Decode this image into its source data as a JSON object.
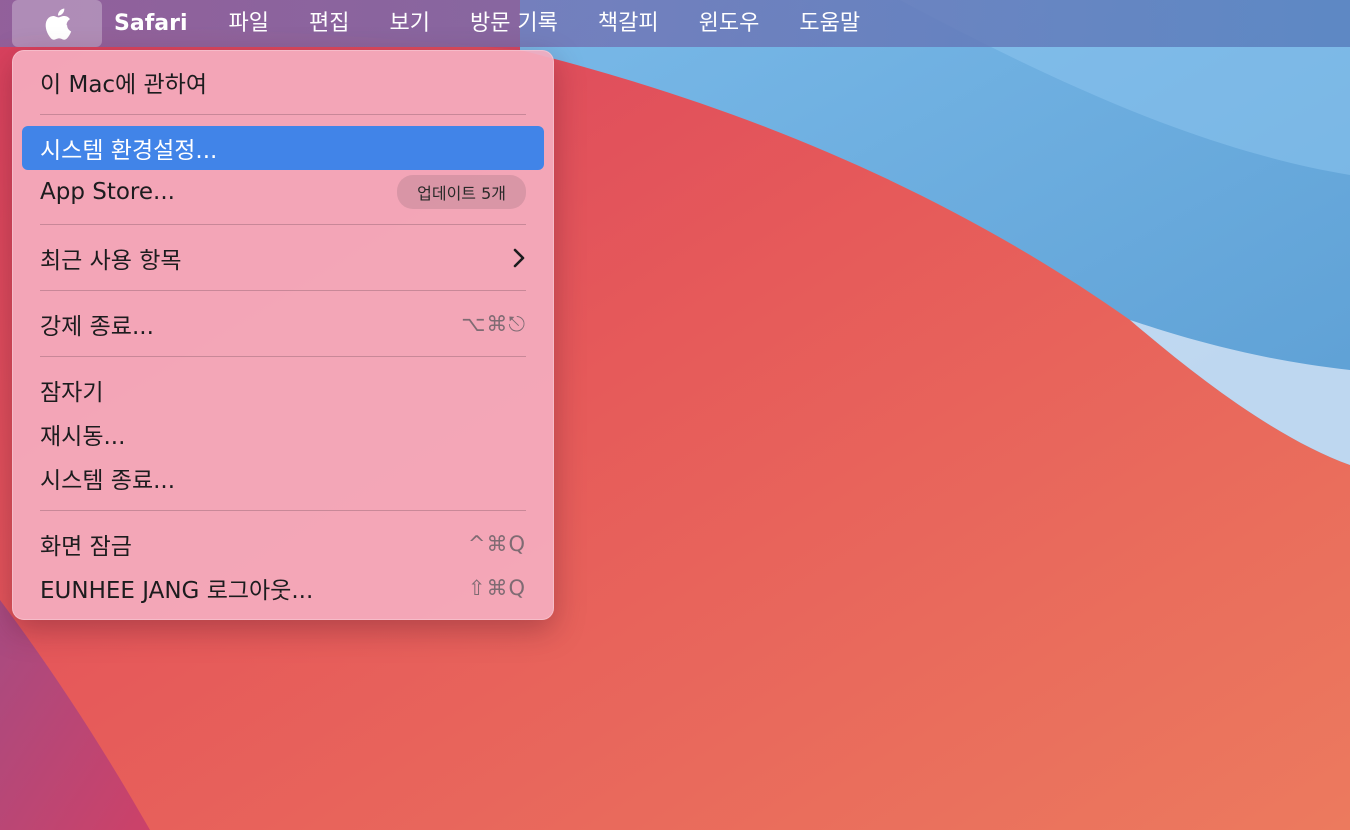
{
  "menubar": {
    "apple_icon": "apple-logo-icon",
    "app_name": "Safari",
    "items": [
      "파일",
      "편집",
      "보기",
      "방문 기록",
      "책갈피",
      "윈도우",
      "도움말"
    ]
  },
  "apple_menu": {
    "about": "이 Mac에 관하여",
    "system_preferences": "시스템 환경설정...",
    "app_store": "App Store...",
    "app_store_badge": "업데이트 5개",
    "recent_items": "최근 사용 항목",
    "force_quit": "강제 종료...",
    "force_quit_shortcut": "⌥⌘⎋",
    "sleep": "잠자기",
    "restart": "재시동...",
    "shut_down": "시스템 종료...",
    "lock_screen": "화면 잠금",
    "lock_screen_shortcut": "^⌘Q",
    "log_out": "EUNHEE JANG 로그아웃...",
    "log_out_shortcut": "⇧⌘Q"
  },
  "colors": {
    "highlight": "#4184e8",
    "menu_background": "#f4acbe",
    "menubar_text": "#ffffff"
  }
}
